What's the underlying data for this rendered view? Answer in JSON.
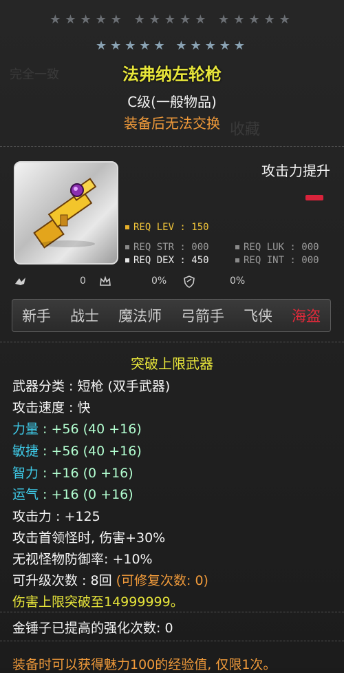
{
  "header": {
    "stars_top": "★★★★★ ★★★★★ ★★★★★",
    "stars": "★★★★★ ★★★★★",
    "ghost_left": "完全一致",
    "ghost_right": "收藏"
  },
  "item": {
    "name": "法弗纳左轮枪",
    "grade": "C级(一般物品)",
    "trade_note": "装备后无法交换",
    "attack_label": "攻击力提升"
  },
  "requirements": {
    "lev": "REQ LEV : 150",
    "str": "REQ STR : 000",
    "luk": "REQ LUK : 000",
    "dex": "REQ DEX : 450",
    "int": "REQ INT : 000"
  },
  "icons_row": {
    "v1": "0",
    "v2": "0%",
    "v3": "0%"
  },
  "jobs": [
    "新手",
    "战士",
    "魔法师",
    "弓箭手",
    "飞侠",
    "海盗"
  ],
  "active_job_index": 5,
  "details": {
    "section_title": "突破上限武器",
    "category": "武器分类 : 短枪 (双手武器)",
    "speed": "攻击速度 : 快",
    "str_label": "力量",
    "str_value": " : +56 (40 +16)",
    "dex_label": "敏捷",
    "dex_value": " : +56 (40 +16)",
    "int_label": "智力",
    "int_value": " : +16 (0 +16)",
    "luk_label": "运气",
    "luk_value": " : +16 (0 +16)",
    "attack": "攻击力 : +125",
    "boss_damage": "攻击首领怪时, 伤害+30%",
    "ignore_def": "无视怪物防御率: +10%",
    "upgrades": "可升级次数 : 8回",
    "repairs": " (可修复次数: 0)",
    "damage_cap": "伤害上限突破至14999999。",
    "hammer": "金锤子已提高的强化次数: 0",
    "footer": "装备时可以获得魅力100的经验值, 仅限1次。"
  },
  "colors": {
    "title": "#e7e53a",
    "orange": "#f09a3a",
    "cyan": "#3ec9e6",
    "active_job": "#e22a3a"
  }
}
